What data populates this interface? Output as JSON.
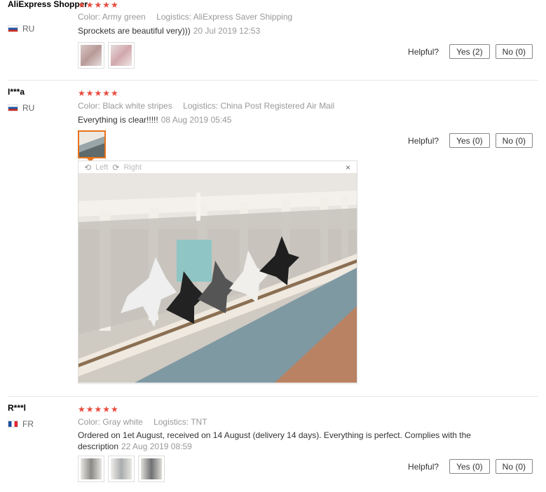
{
  "reviews": [
    {
      "user": "AliExpress Shopper",
      "country": "RU",
      "stars": "★★★★★",
      "color_label": "Color:",
      "color_value": "Army green",
      "logistics_label": "Logistics:",
      "logistics_value": "AliExpress Saver Shipping",
      "comment": "Sprockets are beautiful very)))",
      "date": "20 Jul 2019 12:53",
      "helpful_label": "Helpful?",
      "yes_label": "Yes (2)",
      "no_label": "No (0)"
    },
    {
      "user": "I***a",
      "country": "RU",
      "stars": "★★★★★",
      "color_label": "Color:",
      "color_value": "Black white stripes",
      "logistics_label": "Logistics:",
      "logistics_value": "China Post Registered Air Mail",
      "comment": "Everything is clear!!!!!",
      "date": "08 Aug 2019 05:45",
      "helpful_label": "Helpful?",
      "yes_label": "Yes (0)",
      "no_label": "No (0)",
      "viewer": {
        "left_label": "Left",
        "right_label": "Right",
        "close_label": "×"
      }
    },
    {
      "user": "R***l",
      "country": "FR",
      "stars": "★★★★★",
      "color_label": "Color:",
      "color_value": "Gray white",
      "logistics_label": "Logistics:",
      "logistics_value": "TNT",
      "comment": "Ordered on 1et August, received on 14 August (delivery 14 days). Everything is perfect. Complies with the description",
      "date": "22 Aug 2019 08:59",
      "helpful_label": "Helpful?",
      "yes_label": "Yes (0)",
      "no_label": "No (0)"
    }
  ],
  "icons": {
    "rotate_left": "rotate-left-icon",
    "rotate_right": "rotate-right-icon",
    "close": "close-icon"
  },
  "colors": {
    "star": "#e94a3c",
    "thumb_selected": "#e8731b"
  }
}
